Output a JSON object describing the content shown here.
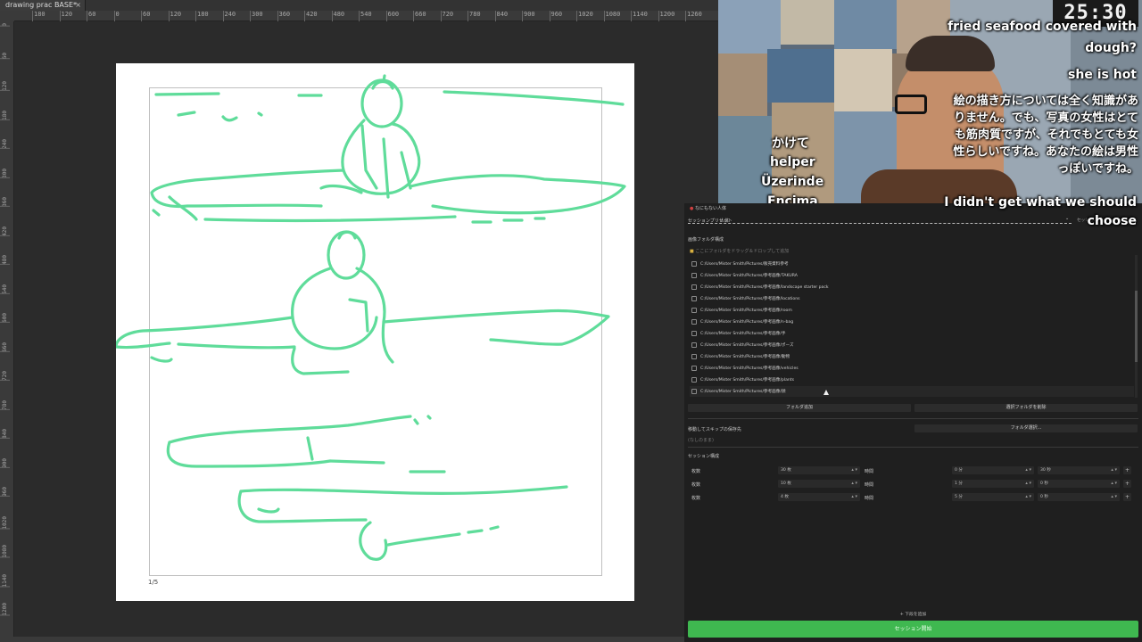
{
  "drawing_app": {
    "tab_title": "drawing prac BASE*",
    "tab_close": "×",
    "ruler_top": [
      "180",
      "120",
      "60",
      "0",
      "60",
      "120",
      "180",
      "240",
      "300",
      "360",
      "420",
      "480",
      "540",
      "600",
      "660",
      "720",
      "780",
      "840",
      "900",
      "960",
      "1020",
      "1080",
      "1140",
      "1200",
      "1260"
    ],
    "ruler_left": [
      "0",
      "60",
      "120",
      "180",
      "240",
      "300",
      "360",
      "420",
      "480",
      "540",
      "600",
      "660",
      "720",
      "780",
      "840",
      "900",
      "960",
      "1020",
      "1080",
      "1140",
      "1200"
    ],
    "page_number": "1/5",
    "stroke_color": "#5fdc9a"
  },
  "webcam": {
    "timer": "25:30",
    "captions_en": {
      "line1": "fried seafood covered with",
      "line2": "dough?",
      "line3": "she is hot",
      "bottom1": "I didn't get what we should",
      "bottom2": "choose"
    },
    "captions_jp": [
      "絵の描き方については全く知識があ",
      "りません。でも、写真の女性はとて",
      "も筋肉質ですが、それでもとても女",
      "性らしいですね。あなたの絵は男性",
      "っぽいですね。"
    ],
    "captions_center": [
      "かけて",
      "helper",
      "Üzerinde",
      "Encima"
    ]
  },
  "reference_app": {
    "title": "なにもない人体",
    "session_preset_label": "セッションプリセット",
    "session_preset_value": "人体",
    "folder_section_label": "画像フォルダ構成",
    "drop_hint": "ここにフォルダをドラッグ＆ドロップして追加",
    "folders": [
      "C:/Users/Mister Smith/Pictures/販売資料参考",
      "C:/Users/Mister Smith/Pictures/参考画像/TAKURA",
      "C:/Users/Mister Smith/Pictures/参考画像/landscape starter pack",
      "C:/Users/Mister Smith/Pictures/参考画像/locations",
      "C:/Users/Mister Smith/Pictures/参考画像/room",
      "C:/Users/Mister Smith/Pictures/参考画像/n-bag",
      "C:/Users/Mister Smith/Pictures/参考画像/手",
      "C:/Users/Mister Smith/Pictures/参考画像/ポーズ",
      "C:/Users/Mister Smith/Pictures/参考画像/動物",
      "C:/Users/Mister Smith/Pictures/参考画像/vehicles",
      "C:/Users/Mister Smith/Pictures/参考画像/plants",
      "C:/Users/Mister Smith/Pictures/参考画像/顔"
    ],
    "add_folder_button": "フォルダ追加",
    "remove_folder_button": "選択フォルダを削除",
    "skip_dest_label": "移動してスキップの保存先",
    "skip_dest_value": "(なしのまま)",
    "choose_folder_button": "フォルダ選択...",
    "session_config_label": "セッション構成",
    "session_rows": [
      {
        "count_label": "枚数",
        "count_value": "30 枚",
        "time_label": "時間",
        "min_value": "0 分",
        "sec_value": "30 秒"
      },
      {
        "count_label": "枚数",
        "count_value": "10 枚",
        "time_label": "時間",
        "min_value": "1 分",
        "sec_value": "0 秒"
      },
      {
        "count_label": "枚数",
        "count_value": "4 枚",
        "time_label": "時間",
        "min_value": "5 分",
        "sec_value": "0 秒"
      }
    ],
    "add_preset": "+ 下段を追加",
    "start_button": "セッション開始",
    "plus": "+",
    "updown": "▴ ▾",
    "chevron": "⌄",
    "top_right_label": "セッション"
  }
}
